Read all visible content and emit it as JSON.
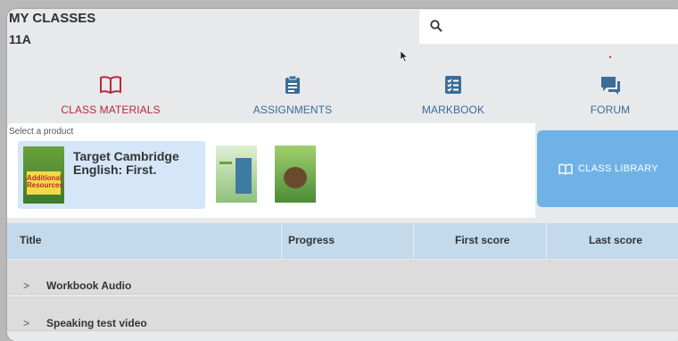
{
  "header": {
    "title": "MY CLASSES",
    "class_name": "11A"
  },
  "search": {
    "placeholder": ""
  },
  "tabs": [
    {
      "label": "CLASS MATERIALS",
      "icon": "book-icon",
      "active": true
    },
    {
      "label": "ASSIGNMENTS",
      "icon": "clipboard-icon",
      "active": false
    },
    {
      "label": "MARKBOOK",
      "icon": "checklist-icon",
      "active": false
    },
    {
      "label": "FORUM",
      "icon": "chat-icon",
      "active": false
    }
  ],
  "products": {
    "select_label": "Select a product",
    "items": [
      {
        "name": "Target Cambridge English: First.",
        "cover_text": "Additional Resources",
        "selected": true
      },
      {
        "name": "",
        "selected": false
      },
      {
        "name": "",
        "selected": false
      }
    ]
  },
  "class_library": {
    "label": "CLASS LIBRARY"
  },
  "table": {
    "columns": [
      "Title",
      "Progress",
      "First score",
      "Last score"
    ],
    "rows": [
      {
        "title": "Workbook Audio"
      },
      {
        "title": "Speaking test video"
      }
    ]
  },
  "colors": {
    "accent_red": "#b8283c",
    "accent_blue": "#3a6c99",
    "library_button": "#6fb3e6",
    "table_header": "#c3d9ec"
  }
}
